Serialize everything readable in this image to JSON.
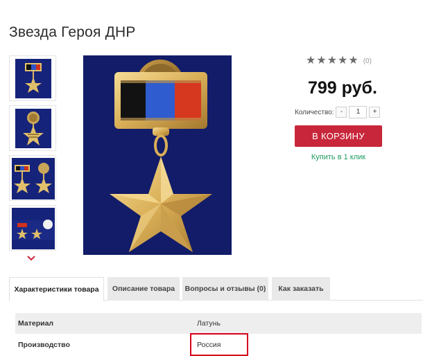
{
  "product": {
    "title": "Звезда Героя ДНР"
  },
  "thumbnails": [
    {
      "name": "medal-front"
    },
    {
      "name": "medal-back"
    },
    {
      "name": "medal-pair"
    },
    {
      "name": "medal-box"
    }
  ],
  "rating": {
    "stars_filled": 5,
    "stars_total": 5,
    "review_count": "(0)"
  },
  "price": "799 руб.",
  "quantity": {
    "label": "Количество:",
    "value": "1",
    "minus": "-",
    "plus": "+"
  },
  "cart_button": "В КОРЗИНУ",
  "one_click": "Купить в 1 клик",
  "tabs": [
    {
      "label": "Характеристики товара",
      "active": true
    },
    {
      "label": "Описание товара",
      "active": false
    },
    {
      "label": "Вопросы и отзывы (0)",
      "active": false
    },
    {
      "label": "Как заказать",
      "active": false
    }
  ],
  "specs": [
    {
      "key": "Материал",
      "value": "Латунь"
    },
    {
      "key": "Производство",
      "value": "Россия"
    }
  ],
  "colors": {
    "cart_button": "#c8263a",
    "one_click_link": "#1d9b62",
    "image_background": "#121c68",
    "highlight_border": "#d6001c"
  }
}
